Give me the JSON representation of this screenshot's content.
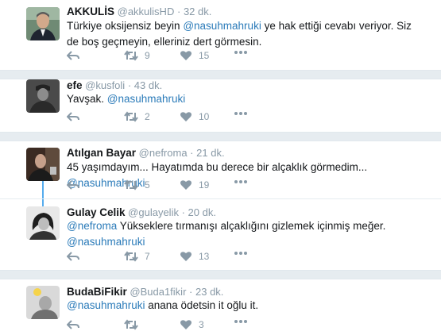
{
  "tweets": [
    {
      "name": "AKKULİS",
      "handle": "@akkulisHD",
      "time": "32 dk.",
      "text_before": "Türkiye oksijensiz beyin ",
      "mention": "@nasuhmahruki",
      "text_after": " ye hak ettiği cevabı veriyor. Siz de boş geçmeyin, elleriniz dert görmesin.",
      "retweets": "9",
      "likes": "15"
    },
    {
      "name": "efe",
      "handle": "@kusfoli",
      "time": "43 dk.",
      "text_before": "Yavşak. ",
      "mention": "@nasuhmahruki",
      "text_after": "",
      "retweets": "2",
      "likes": "10"
    },
    {
      "name": "Atılgan Bayar",
      "handle": "@nefroma",
      "time": "21 dk.",
      "text_before": "45 yaşımdayım... Hayatımda bu derece bir alçaklık görmedim... ",
      "mention": "@nasuhmahruki",
      "text_after": "",
      "retweets": "5",
      "likes": "19"
    },
    {
      "name": "Gulay Celik",
      "handle": "@gulayelik",
      "time": "20 dk.",
      "mention_a": "@nefroma",
      "text_mid": " Yükseklere tırmanışı alçaklığını gizlemek içinmiş meğer.",
      "mention_b": "@nasuhmahruki",
      "retweets": "7",
      "likes": "13"
    },
    {
      "name": "BudaBiFikir",
      "handle": "@Buda1fikir",
      "time": "23 dk.",
      "mention": "@nasuhmahruki",
      "text_after": " anana ödetsin it oğlu it.",
      "retweets": "",
      "likes": "3"
    }
  ],
  "dot": "·",
  "icons": [
    "reply-icon",
    "retweet-icon",
    "like-icon",
    "more-icon"
  ],
  "colors": {
    "mention": "#2b7bb9",
    "muted": "#8899a6",
    "thread": "#55acee",
    "separator": "#e6ecf0"
  }
}
